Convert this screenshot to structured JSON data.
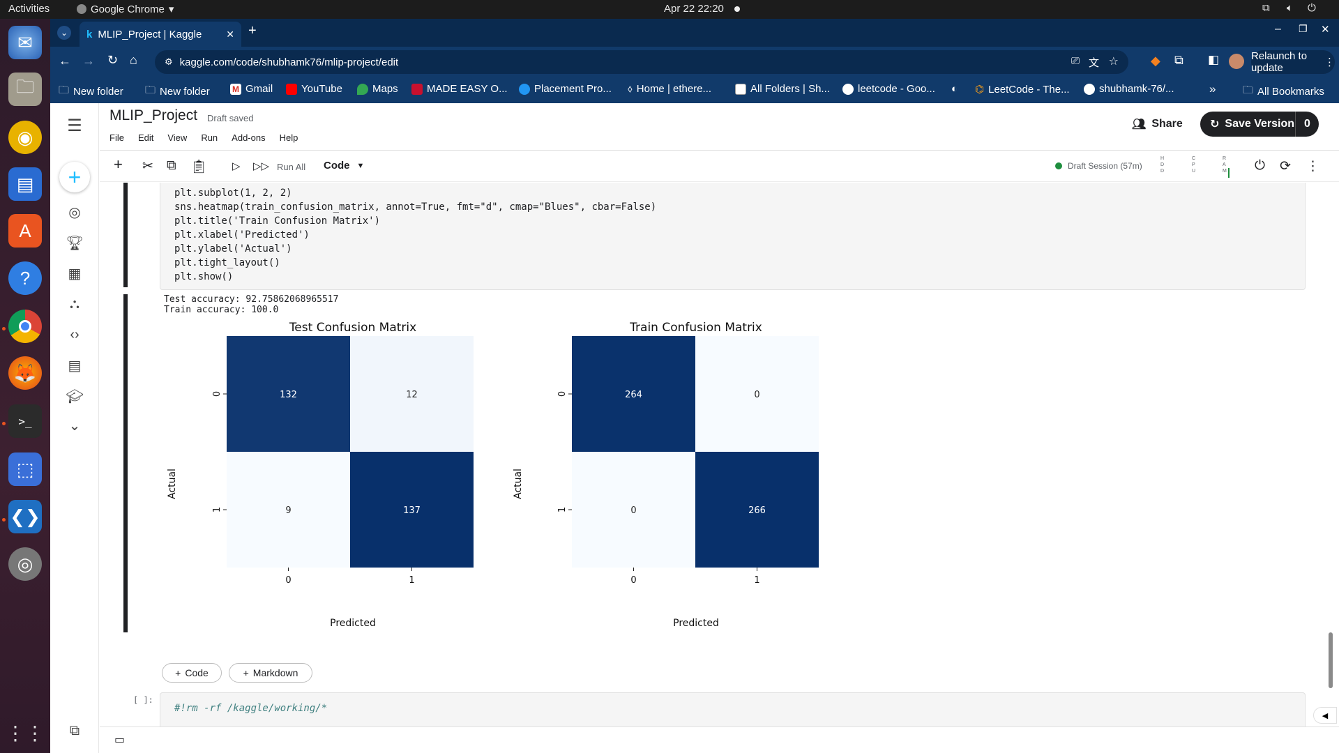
{
  "os": {
    "activities": "Activities",
    "app_name": "Google Chrome",
    "clock": "Apr 22  22:20"
  },
  "browser": {
    "tab_title": "MLIP_Project | Kaggle",
    "url": "kaggle.com/code/shubhamk76/mlip-project/edit",
    "relaunch": "Relaunch to update",
    "bookmarks": [
      "New folder",
      "New folder",
      "Gmail",
      "YouTube",
      "Maps",
      "MADE EASY O...",
      "Placement Pro...",
      "Home | ethere...",
      "All Folders | Sh...",
      "leetcode - Goo...",
      "",
      "LeetCode - The...",
      "shubhamk-76/..."
    ],
    "all_bookmarks": "All Bookmarks"
  },
  "kaggle": {
    "title": "MLIP_Project",
    "saved_status": "Draft saved",
    "menu": [
      "File",
      "Edit",
      "View",
      "Run",
      "Add-ons",
      "Help"
    ],
    "share": "Share",
    "save_version": "Save Version",
    "save_count": "0",
    "run_all": "Run All",
    "cell_type": "Code",
    "session": "Draft Session (57m)",
    "hdd": "HDD",
    "cpu": "CPU",
    "ram": "RAM"
  },
  "cell1": {
    "lines": [
      "plt.subplot(1, 2, 2)",
      "sns.heatmap(train_confusion_matrix, annot=True, fmt=\"d\", cmap=\"Blues\", cbar=False)",
      "plt.title('Train Confusion Matrix')",
      "plt.xlabel('Predicted')",
      "plt.ylabel('Actual')",
      "plt.tight_layout()",
      "plt.show()"
    ],
    "output_text_1": "Test accuracy: 92.75862068965517",
    "output_text_2": "Train accuracy: 100.0"
  },
  "add_code": "Code",
  "add_markdown": "Markdown",
  "cell2": {
    "prompt": "[ ]:",
    "code": "#!rm -rf /kaggle/working/*"
  },
  "chart_data": [
    {
      "type": "heatmap",
      "title": "Test Confusion Matrix",
      "xlabel": "Predicted",
      "ylabel": "Actual",
      "x_ticks": [
        "0",
        "1"
      ],
      "y_ticks": [
        "0",
        "1"
      ],
      "values": [
        [
          132,
          12
        ],
        [
          9,
          137
        ]
      ],
      "colormap": "Blues",
      "colors": {
        "high": "#08306b",
        "low": "#f7fbff"
      }
    },
    {
      "type": "heatmap",
      "title": "Train Confusion Matrix",
      "xlabel": "Predicted",
      "ylabel": "Actual",
      "x_ticks": [
        "0",
        "1"
      ],
      "y_ticks": [
        "0",
        "1"
      ],
      "values": [
        [
          264,
          0
        ],
        [
          0,
          266
        ]
      ],
      "colormap": "Blues",
      "colors": {
        "high": "#08306b",
        "low": "#f7fbff"
      }
    }
  ]
}
